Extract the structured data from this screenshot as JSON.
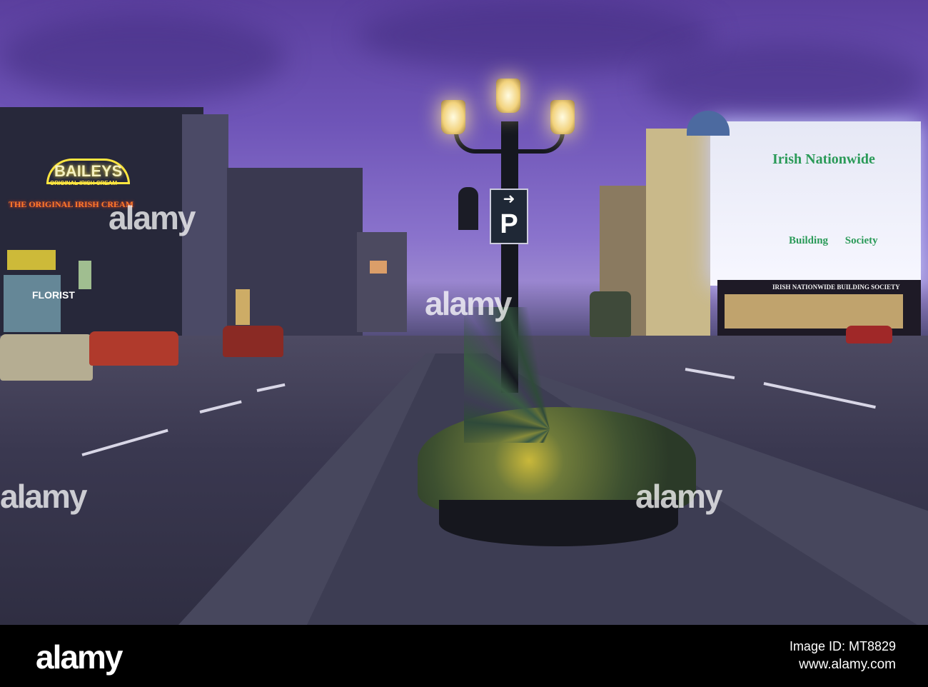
{
  "photo": {
    "signs": {
      "baileys": "BAILEYS",
      "baileys_sub": "ORIGINAL IRISH CREAM",
      "original": "THE ORIGINAL IRISH CREAM",
      "florist": "FLORIST",
      "nationwide_top": "Irish Nationwide",
      "nationwide_mid": "Building Society",
      "nationwide_shop": "IRISH NATIONWIDE BUILDING SOCIETY",
      "parking": "P"
    },
    "watermark": "alamy"
  },
  "footer": {
    "logo": "alamy",
    "image_id": "Image ID: MT8829",
    "url": "www.alamy.com"
  }
}
